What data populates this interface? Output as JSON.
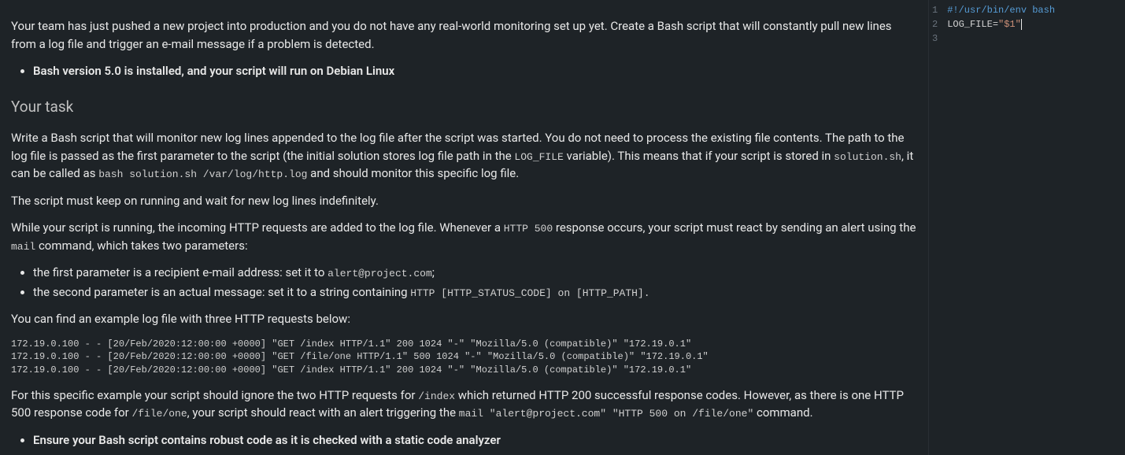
{
  "problem": {
    "intro": "Your team has just pushed a new project into production and you do not have any real-world monitoring set up yet. Create a Bash script that will constantly pull new lines from a log file and trigger an e-mail message if a problem is detected.",
    "bullet1": "Bash version 5.0 is installed, and your script will run on Debian Linux",
    "heading_task": "Your task",
    "task_p1_a": "Write a Bash script that will monitor new log lines appended to the log file after the script was started. You do not need to process the existing file contents. The path to the log file is passed as the first parameter to the script (the initial solution stores log file path in the ",
    "task_p1_code1": "LOG_FILE",
    "task_p1_b": " variable). This means that if your script is stored in ",
    "task_p1_code2": "solution.sh",
    "task_p1_c": ", it can be called as ",
    "task_p1_code3": "bash solution.sh /var/log/http.log",
    "task_p1_d": " and should monitor this specific log file.",
    "task_p2": "The script must keep on running and wait for new log lines indefinitely.",
    "task_p3_a": "While your script is running, the incoming HTTP requests are added to the log file. Whenever a ",
    "task_p3_code1": "HTTP 500",
    "task_p3_b": " response occurs, your script must react by sending an alert using the ",
    "task_p3_code2": "mail",
    "task_p3_c": " command, which takes two parameters:",
    "li_param1_a": "the first parameter is a recipient e-mail address: set it to ",
    "li_param1_code": "alert@project.com",
    "li_param1_b": ";",
    "li_param2_a": "the second parameter is an actual message: set it to a string containing ",
    "li_param2_code": "HTTP [HTTP_STATUS_CODE] on [HTTP_PATH].",
    "example_intro": "You can find an example log file with three HTTP requests below:",
    "log_example": "172.19.0.100 - - [20/Feb/2020:12:00:00 +0000] \"GET /index HTTP/1.1\" 200 1024 \"-\" \"Mozilla/5.0 (compatible)\" \"172.19.0.1\"\n172.19.0.100 - - [20/Feb/2020:12:00:00 +0000] \"GET /file/one HTTP/1.1\" 500 1024 \"-\" \"Mozilla/5.0 (compatible)\" \"172.19.0.1\"\n172.19.0.100 - - [20/Feb/2020:12:00:00 +0000] \"GET /index HTTP/1.1\" 200 1024 \"-\" \"Mozilla/5.0 (compatible)\" \"172.19.0.1\"",
    "conclusion_a": "For this specific example your script should ignore the two HTTP requests for ",
    "conclusion_code1": "/index",
    "conclusion_b": " which returned HTTP 200 successful response codes. However, as there is one HTTP 500 response code for ",
    "conclusion_code2": "/file/one",
    "conclusion_c": ", your script should react with an alert triggering the ",
    "conclusion_code3": "mail \"alert@project.com\" \"HTTP 500 on /file/one\"",
    "conclusion_d": " command.",
    "bullet_last": "Ensure your Bash script contains robust code as it is checked with a static code analyzer"
  },
  "editor": {
    "gutter": [
      "1",
      "2",
      "3"
    ],
    "line1": "#!/usr/bin/env bash",
    "line2_a": "LOG_FILE=",
    "line2_b": "\"$1\""
  }
}
